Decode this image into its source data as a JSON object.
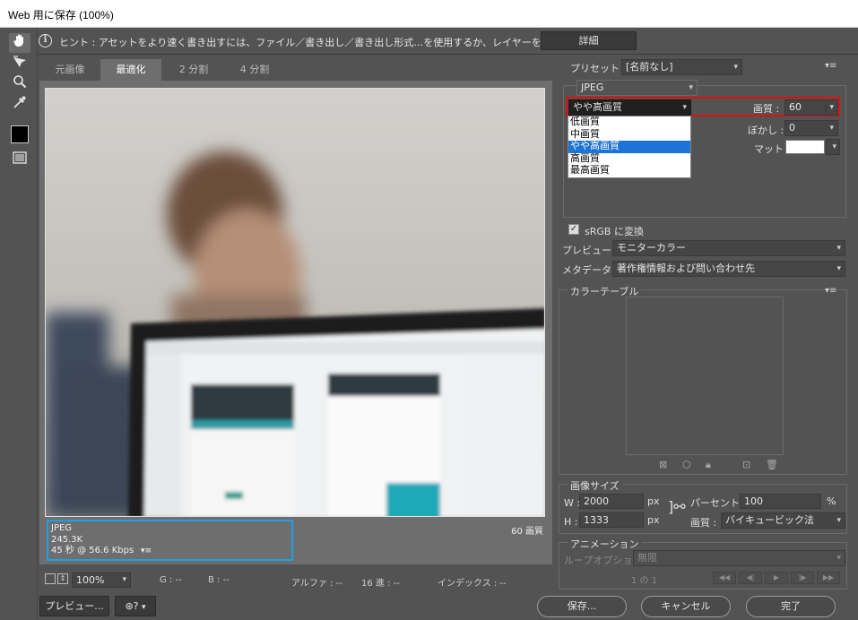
{
  "window": {
    "title": "Web 用に保存 (100%)"
  },
  "hint": {
    "text": "ヒント : アセットをより速く書き出すには、ファイル／書き出し／書き出し形式…を使用するか、レイヤーを右クリックして使用。",
    "details_button": "詳細"
  },
  "tools": [
    "hand-tool-icon",
    "slice-select-tool-icon",
    "zoom-tool-icon",
    "eyedropper-tool-icon",
    "eyedropper-color-swatch",
    "toggle-slices-visibility-icon"
  ],
  "tabs": [
    {
      "label": "元画像",
      "active": false
    },
    {
      "label": "最適化",
      "active": true
    },
    {
      "label": "2 分割",
      "active": false
    },
    {
      "label": "4 分割",
      "active": false
    }
  ],
  "preview_info": {
    "format": "JPEG",
    "size": "245.3K",
    "download_time": "45 秒 @ 56.6 Kbps",
    "quality_label": "60 画質"
  },
  "statusbar": {
    "zoom": "100%",
    "g": "G : --",
    "b": "B : --",
    "alpha": "アルファ : --",
    "hex": "16 進 : --",
    "index": "インデックス : --"
  },
  "bottom_buttons": {
    "preview": "プレビュー...",
    "save": "保存...",
    "cancel": "キャンセル",
    "done": "完了"
  },
  "settings": {
    "preset_label": "プリセット :",
    "preset_value": "[名前なし]",
    "format_value": "JPEG",
    "quality_preset_value": "やや高画質",
    "quality_label": "画質 :",
    "quality_value": "60",
    "blur_label": "ぼかし :",
    "blur_value": "0",
    "matte_label": "マット :",
    "quality_options": [
      "低画質",
      "中画質",
      "やや高画質",
      "高画質",
      "最高画質"
    ],
    "quality_options_selected_index": 2,
    "srgb_label": "sRGB に変換",
    "srgb_checked": true,
    "preview_label": "プレビュー :",
    "preview_value": "モニターカラー",
    "metadata_label": "メタデータ :",
    "metadata_value": "著作権情報および問い合わせ先"
  },
  "color_table": {
    "title": "カラーテーブル"
  },
  "image_size": {
    "title": "画像サイズ",
    "w_label": "W :",
    "w_value": "2000",
    "h_label": "H :",
    "h_value": "1333",
    "px": "px",
    "percent_label": "パーセント :",
    "percent_value": "100",
    "percent_unit": "%",
    "quality_label": "画質 :",
    "quality_value": "バイキュービック法"
  },
  "animation": {
    "title": "アニメーション",
    "loop_label": "ループオプション :",
    "loop_value": "無限",
    "frame_counter": "1 の 1"
  },
  "colors": {
    "highlight_red": "#e01010",
    "info_blue": "#1ea0e6",
    "selected_blue": "#1e74d4"
  }
}
